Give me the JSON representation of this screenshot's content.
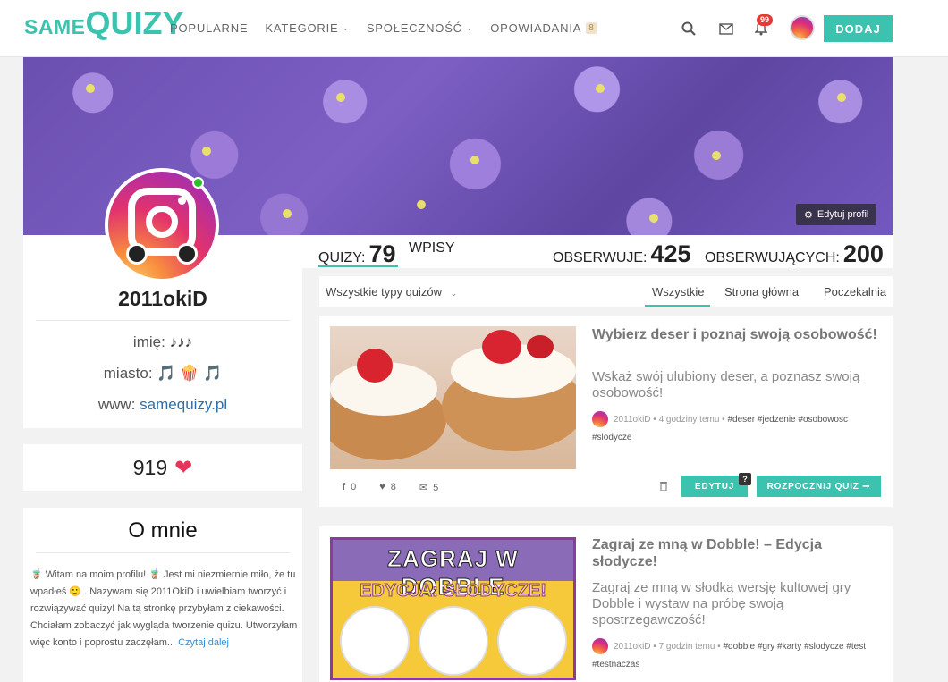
{
  "nav": {
    "logo_prefix": "SAME",
    "logo_main": "QUIZY",
    "menu": [
      {
        "label": "POPULARNE"
      },
      {
        "label": "KATEGORIE"
      },
      {
        "label": "SPOŁECZNOŚĆ"
      },
      {
        "label": "OPOWIADANIA",
        "badge": "8"
      }
    ],
    "notifications_count": "99",
    "add_label": "DODAJ",
    "accent": "#3cc3b0"
  },
  "cover": {
    "edit_label": "Edytuj profil"
  },
  "profile": {
    "username": "2011okiD",
    "name_label": "imię:",
    "name_value": "♪♪♪",
    "city_label": "miasto:",
    "city_value": "🎵 🍿 🎵",
    "www_label": "www:",
    "www_value": "samequizy.pl",
    "likes": "919"
  },
  "about": {
    "title": "O mnie",
    "text": "🧋 Witam na moim profilu! 🧋 Jest mi niezmiernie miło, że tu wpadłeś 🙂 . Nazywam się 2011OkiD i uwielbiam tworzyć i rozwiązywać quizy! Na tą stronkę przybyłam z ciekawości. Chciałam zobaczyć jak wygląda tworzenie quizu. Utworzyłam więc konto i poprostu zaczęłam...",
    "read_more": "Czytaj dalej"
  },
  "stats": {
    "quizzes_label": "QUIZY:",
    "quizzes_value": "79",
    "posts_label": "WPISY",
    "following_label": "OBSERWUJE:",
    "following_value": "425",
    "followers_label": "OBSERWUJĄCYCH:",
    "followers_value": "200"
  },
  "filters": {
    "type_dropdown": "Wszystkie typy quizów",
    "tabs": [
      "Wszystkie",
      "Strona główna",
      "Poczekalnia"
    ]
  },
  "quizzes": [
    {
      "title": "Wybierz deser i poznaj swoją osobowość!",
      "description": "Wskaż swój ulubiony deser, a poznasz swoją osobowość!",
      "author": "2011okiD",
      "time": " • 4 godziny temu • ",
      "tags": "#deser #jedzenie #osobowosc #slodycze",
      "shares": "0",
      "likes": "8",
      "comments": "5",
      "edit_label": "EDYTUJ",
      "help_label": "?",
      "start_label": "ROZPOCZNIJ QUIZ ➞"
    },
    {
      "title": "Zagraj ze mną w Dobble! – Edycja słodycze!",
      "description": "Zagraj ze mną w słodką wersję kultowej gry Dobble i wystaw na próbę swoją spostrzegawczość!",
      "author": "2011okiD",
      "time": " • 7 godzin temu • ",
      "tags": "#dobble #gry #karty #slodycze #test #testnaczas",
      "thumb_title": "ZAGRAJ W DOBBLE",
      "thumb_subtitle": "EDYCJA: SŁODYCZE!"
    }
  ]
}
